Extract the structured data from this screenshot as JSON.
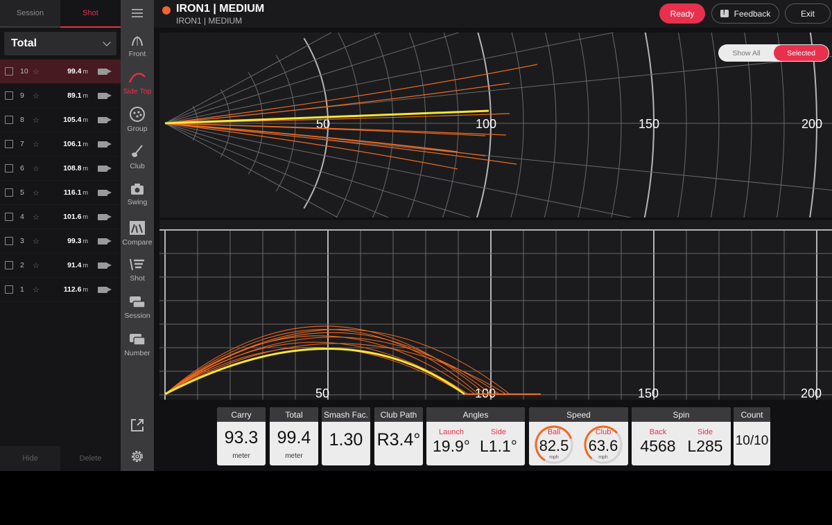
{
  "left": {
    "tabs": [
      "Session",
      "Shot"
    ],
    "filter": "Total",
    "unit": "m",
    "shots": [
      {
        "n": "10",
        "d": "99.4",
        "sel": true
      },
      {
        "n": "9",
        "d": "89.1"
      },
      {
        "n": "8",
        "d": "105.4"
      },
      {
        "n": "7",
        "d": "106.1"
      },
      {
        "n": "6",
        "d": "108.8"
      },
      {
        "n": "5",
        "d": "116.1"
      },
      {
        "n": "4",
        "d": "101.6"
      },
      {
        "n": "3",
        "d": "99.3"
      },
      {
        "n": "2",
        "d": "91.4"
      },
      {
        "n": "1",
        "d": "112.6"
      }
    ],
    "hide_label": "Hide",
    "delete_label": "Delete"
  },
  "nav": {
    "items": [
      {
        "label": "Front",
        "icon": "front-icon"
      },
      {
        "label": "Side Top",
        "icon": "side-top-icon",
        "active": true
      },
      {
        "label": "Group",
        "icon": "group-icon"
      },
      {
        "label": "Club",
        "icon": "club-icon"
      },
      {
        "label": "Swing",
        "icon": "swing-icon"
      },
      {
        "label": "Compare",
        "icon": "compare-icon"
      },
      {
        "label": "Shot",
        "icon": "shot-icon"
      },
      {
        "label": "Session",
        "icon": "session-icon"
      },
      {
        "label": "Number",
        "icon": "number-icon"
      }
    ]
  },
  "header": {
    "title": "IRON1 | MEDIUM",
    "subtitle": "IRON1 | MEDIUM",
    "ready": "Ready",
    "feedback": "Feedback",
    "exit": "Exit"
  },
  "view": {
    "show_all": "Show All",
    "selected": "Selected",
    "distance_labels": [
      "50",
      "100",
      "150",
      "200"
    ]
  },
  "stats": {
    "carry": {
      "label": "Carry",
      "value": "93.3",
      "unit": "meter"
    },
    "total": {
      "label": "Total",
      "value": "99.4",
      "unit": "meter"
    },
    "smash": {
      "label": "Smash Fac.",
      "value": "1.30"
    },
    "club_path": {
      "label": "Club Path",
      "value": "R3.4°"
    },
    "angles": {
      "label": "Angles",
      "launch_label": "Launch",
      "launch": "19.9°",
      "side_label": "Side",
      "side": "L1.1°"
    },
    "speed": {
      "label": "Speed",
      "ball_label": "Ball",
      "ball": "82.5",
      "club_label": "Club",
      "club": "63.6",
      "unit": "mph"
    },
    "spin": {
      "label": "Spin",
      "back_label": "Back",
      "back": "4568",
      "side_label": "Side",
      "side": "L285"
    },
    "count": {
      "label": "Count",
      "value": "10/10"
    }
  },
  "colors": {
    "accent": "#e8304d",
    "selected_trace": "#f5e63a",
    "other_traces": "#f06a1e"
  }
}
